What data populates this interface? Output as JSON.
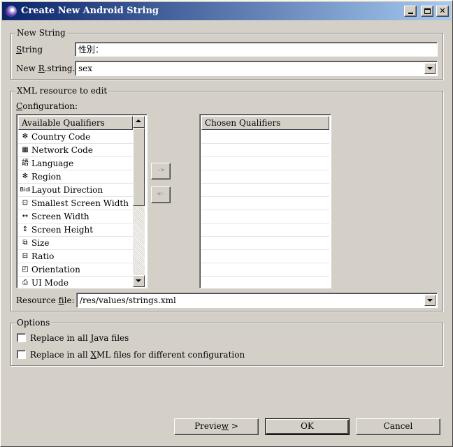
{
  "window": {
    "title": "Create New Android String"
  },
  "new_string": {
    "group_title": "New String",
    "string_label_u": "S",
    "string_label_rest": "tring",
    "string_value": "性別：",
    "rstring_label_pre": "New ",
    "rstring_label_u": "R",
    "rstring_label_rest": ".string.",
    "rstring_value": "sex"
  },
  "xml_resource": {
    "group_title": "XML resource to edit",
    "config_label_u": "C",
    "config_label_rest": "onfiguration:",
    "available_header": "Available Qualifiers",
    "chosen_header": "Chosen Qualifiers",
    "available": [
      {
        "icon": "country-code-icon",
        "glyph": "✻",
        "label": "Country Code"
      },
      {
        "icon": "network-code-icon",
        "glyph": "▦",
        "label": "Network Code"
      },
      {
        "icon": "language-icon",
        "glyph": "語",
        "label": "Language"
      },
      {
        "icon": "region-icon",
        "glyph": "✻",
        "label": "Region"
      },
      {
        "icon": "layout-direction-icon",
        "glyph": "Bidi",
        "label": "Layout Direction"
      },
      {
        "icon": "smallest-screen-width-icon",
        "glyph": "⊡",
        "label": "Smallest Screen Width"
      },
      {
        "icon": "screen-width-icon",
        "glyph": "↔",
        "label": "Screen Width"
      },
      {
        "icon": "screen-height-icon",
        "glyph": "↕",
        "label": "Screen Height"
      },
      {
        "icon": "size-icon",
        "glyph": "⧉",
        "label": "Size"
      },
      {
        "icon": "ratio-icon",
        "glyph": "⊟",
        "label": "Ratio"
      },
      {
        "icon": "orientation-icon",
        "glyph": "◰",
        "label": "Orientation"
      },
      {
        "icon": "ui-mode-icon",
        "glyph": "⎙",
        "label": "UI Mode"
      }
    ],
    "add_button": "->",
    "remove_button": "<-",
    "resource_file_label_pre": "Resource ",
    "resource_file_label_u": "f",
    "resource_file_label_rest": "ile:",
    "resource_file_value": "/res/values/strings.xml"
  },
  "options": {
    "group_title": "Options",
    "java_pre": "Replace in all ",
    "java_u": "J",
    "java_rest": "ava files",
    "xml_pre": "Replace in all ",
    "xml_u": "X",
    "xml_rest": "ML files for different configuration",
    "java_checked": false,
    "xml_checked": false
  },
  "buttons": {
    "preview_pre": "Previe",
    "preview_u": "w",
    "preview_rest": " >",
    "ok": "OK",
    "cancel": "Cancel"
  }
}
